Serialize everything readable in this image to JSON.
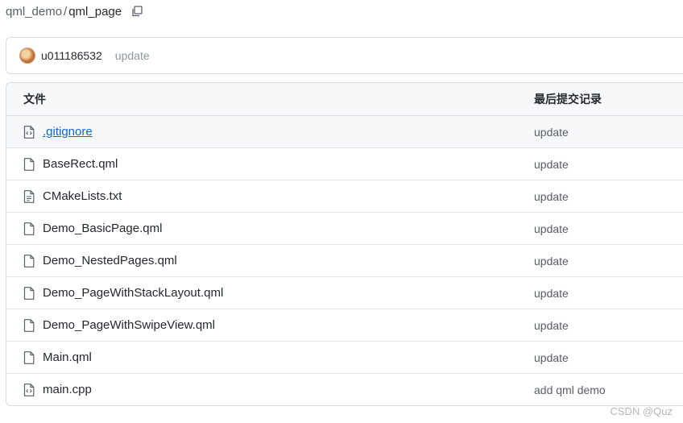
{
  "breadcrumb": {
    "repo": "qml_demo",
    "separator": "/",
    "current": "qml_page"
  },
  "commit": {
    "user": "u011186532",
    "message": "update"
  },
  "table": {
    "headers": {
      "file": "文件",
      "commit": "最后提交记录"
    },
    "rows": [
      {
        "name": ".gitignore",
        "commit": "update",
        "icon": "file-code-icon"
      },
      {
        "name": "BaseRect.qml",
        "commit": "update",
        "icon": "file-icon"
      },
      {
        "name": "CMakeLists.txt",
        "commit": "update",
        "icon": "file-text-icon"
      },
      {
        "name": "Demo_BasicPage.qml",
        "commit": "update",
        "icon": "file-icon"
      },
      {
        "name": "Demo_NestedPages.qml",
        "commit": "update",
        "icon": "file-icon"
      },
      {
        "name": "Demo_PageWithStackLayout.qml",
        "commit": "update",
        "icon": "file-icon"
      },
      {
        "name": "Demo_PageWithSwipeView.qml",
        "commit": "update",
        "icon": "file-icon"
      },
      {
        "name": "Main.qml",
        "commit": "update",
        "icon": "file-icon"
      },
      {
        "name": "main.cpp",
        "commit": "add qml demo",
        "icon": "file-code-icon"
      }
    ]
  },
  "watermark": "CSDN @Quz",
  "colors": {
    "link": "#0969da",
    "border": "#d8dee4",
    "header_bg": "#f6f8fa",
    "muted": "#57606a"
  }
}
